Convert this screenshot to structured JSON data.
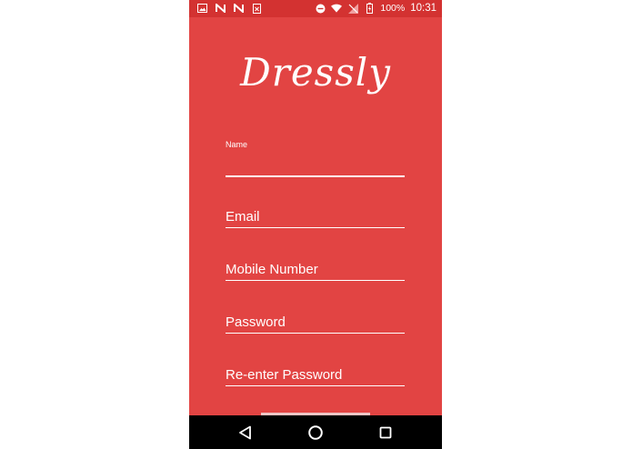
{
  "status_bar": {
    "left_icons": [
      "image-icon",
      "n-icon",
      "n-icon",
      "sim-icon"
    ],
    "battery_percent": "100%",
    "time": "10:31"
  },
  "app": {
    "logo": "Dressly"
  },
  "form": {
    "name_label": "Name",
    "email_label": "Email",
    "mobile_label": "Mobile Number",
    "password_label": "Password",
    "reenter_label": "Re-enter Password"
  },
  "nav": {
    "back": "back-icon",
    "home": "home-icon",
    "recents": "recents-icon"
  },
  "colors": {
    "background": "#e24443",
    "status_bar": "#d33231",
    "nav_bar": "#000000"
  }
}
